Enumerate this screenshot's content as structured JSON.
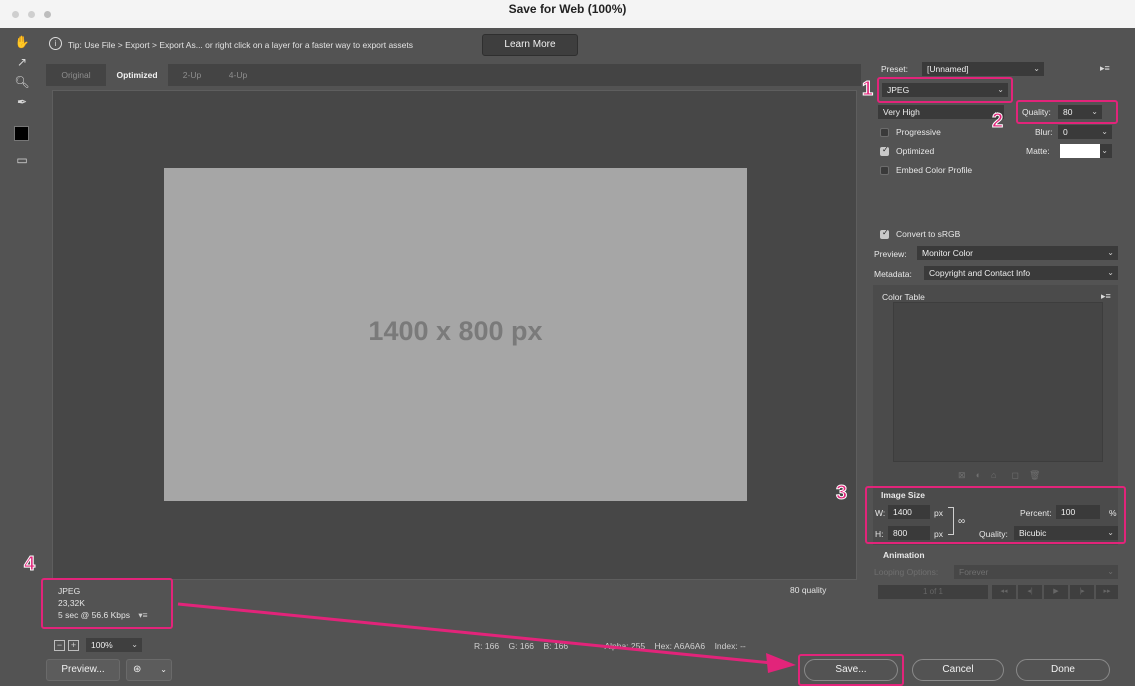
{
  "window": {
    "title": "Save for Web (100%)"
  },
  "tools": {
    "icons": [
      "hand-icon",
      "slice-select-icon",
      "zoom-icon",
      "eyedropper-icon",
      "color-swatch-icon",
      "toggle-slices-icon"
    ]
  },
  "tip": {
    "text": "Tip: Use File > Export > Export As...  or right click on a layer for a faster way to export assets",
    "learn_more": "Learn More"
  },
  "tabs": [
    {
      "label": "Original",
      "active": false
    },
    {
      "label": "Optimized",
      "active": true
    },
    {
      "label": "2-Up",
      "active": false
    },
    {
      "label": "4-Up",
      "active": false
    }
  ],
  "canvas": {
    "image_label": "1400 x 800 px",
    "image_color": "#A6A6A6"
  },
  "status": {
    "format": "JPEG",
    "size": "23,32K",
    "speed": "5 sec @ 56.6 Kbps",
    "quality": "80 quality"
  },
  "zoom": {
    "value": "100%"
  },
  "readout": {
    "r": "R: 166",
    "g": "G: 166",
    "b": "B: 166",
    "alpha": "Alpha: 255",
    "hex": "Hex: A6A6A6",
    "index": "Index: --"
  },
  "buttons": {
    "preview": "Preview...",
    "save": "Save...",
    "cancel": "Cancel",
    "done": "Done"
  },
  "settings": {
    "preset_label": "Preset:",
    "preset_value": "[Unnamed]",
    "format": "JPEG",
    "compression": "Very High",
    "quality_label": "Quality:",
    "quality_value": "80",
    "progressive": "Progressive",
    "blur_label": "Blur:",
    "blur_value": "0",
    "optimized": "Optimized",
    "matte_label": "Matte:",
    "embed_profile": "Embed Color Profile",
    "convert_srgb": "Convert to sRGB",
    "preview_label": "Preview:",
    "preview_value": "Monitor Color",
    "metadata_label": "Metadata:",
    "metadata_value": "Copyright and Contact Info",
    "color_table": "Color Table"
  },
  "image_size": {
    "title": "Image Size",
    "w_label": "W:",
    "w_value": "1400",
    "h_label": "H:",
    "h_value": "800",
    "unit": "px",
    "percent_label": "Percent:",
    "percent_value": "100",
    "percent_unit": "%",
    "quality_label": "Quality:",
    "quality_value": "Bicubic"
  },
  "animation": {
    "title": "Animation",
    "looping_label": "Looping Options:",
    "looping_value": "Forever",
    "frame": "1 of 1"
  },
  "annotations": {
    "color": "#E2247A",
    "labels": [
      "1",
      "2",
      "3",
      "4"
    ]
  }
}
